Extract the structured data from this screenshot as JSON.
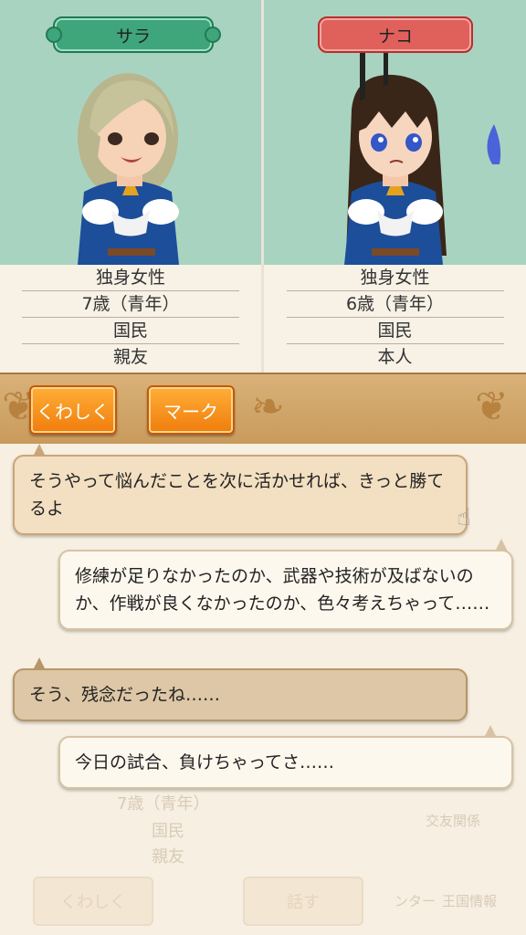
{
  "characters": [
    {
      "name": "サラ",
      "info": [
        "独身女性",
        "7歳（青年）",
        "国民",
        "親友"
      ]
    },
    {
      "name": "ナコ",
      "info": [
        "独身女性",
        "6歳（青年）",
        "国民",
        "本人"
      ]
    }
  ],
  "toolbar": {
    "details_label": "くわしく",
    "mark_label": "マーク"
  },
  "messages": [
    {
      "side": "left",
      "text": "そうやって悩んだことを次に活かせれば、きっと勝てるよ"
    },
    {
      "side": "right",
      "text": "修練が足りなかったのか、武器や技術が及ばないのか、作戦が良くなかったのか、色々考えちゃって……"
    },
    {
      "side": "left",
      "text": "そう、残念だったね……"
    },
    {
      "side": "right",
      "text": "今日の試合、負けちゃってさ……"
    }
  ],
  "background": {
    "info": [
      "7歳（青年）",
      "国民",
      "親友"
    ],
    "details_label": "くわしく",
    "talk_label": "話す",
    "menu_friend": "交友関係",
    "menu_kingdom": "王国情報",
    "menu_center": "ンター"
  },
  "colors": {
    "portrait_bg": "#a9d3c1",
    "accent_orange": "#f07d0c",
    "tag_green": "#3fa57a",
    "tag_red": "#e0605c"
  }
}
